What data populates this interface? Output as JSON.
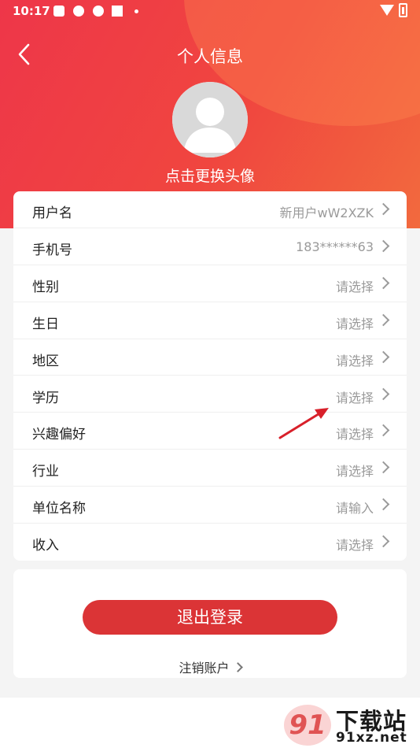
{
  "status_bar": {
    "time": "10:17"
  },
  "header": {
    "title": "个人信息"
  },
  "avatar": {
    "hint": "点击更换头像"
  },
  "profile_rows": [
    {
      "label": "用户名",
      "value": "新用户wW2XZK"
    },
    {
      "label": "手机号",
      "value": "183******63"
    },
    {
      "label": "性别",
      "value": "请选择"
    },
    {
      "label": "生日",
      "value": "请选择"
    },
    {
      "label": "地区",
      "value": "请选择"
    },
    {
      "label": "学历",
      "value": "请选择"
    },
    {
      "label": "兴趣偏好",
      "value": "请选择"
    },
    {
      "label": "行业",
      "value": "请选择"
    },
    {
      "label": "单位名称",
      "value": "请输入"
    },
    {
      "label": "收入",
      "value": "请选择"
    }
  ],
  "actions": {
    "logout_label": "退出登录",
    "cancel_account_label": "注销账户"
  },
  "watermark": {
    "brand": "下载站",
    "domain": "91xz.net",
    "logo_text": "91"
  },
  "colors": {
    "header_start": "#ee3649",
    "header_end": "#f26a3e",
    "logout_button": "#db3436",
    "annotation_arrow": "#d8202a"
  }
}
